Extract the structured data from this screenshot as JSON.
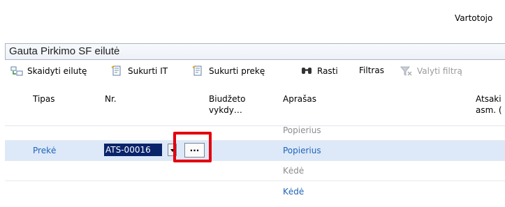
{
  "header": {
    "user_label": "Vartotojo"
  },
  "panel": {
    "title": "Gauta Pirkimo SF eilutė"
  },
  "toolbar": {
    "split_line": "Skaidyti eilutę",
    "create_it": "Sukurti IT",
    "create_item": "Sukurti prekę",
    "find": "Rasti",
    "filter": "Filtras",
    "clear_filter": "Valyti filtrą"
  },
  "columns": {
    "type": "Tipas",
    "nr": "Nr.",
    "budget_1": "Biudžeto",
    "budget_2": "vykdy…",
    "description": "Aprašas",
    "resp_1": "Atsaki",
    "resp_2": "asm. ("
  },
  "rows": [
    {
      "type": "",
      "nr": "",
      "description": "Popierius"
    },
    {
      "type": "Prekė",
      "nr": "ATS-00016",
      "description": "Popierius",
      "ellipsis": "..."
    },
    {
      "type": "",
      "nr": "",
      "description": "Kėdė"
    },
    {
      "type": "",
      "nr": "",
      "description": "Kėdė"
    }
  ],
  "colors": {
    "accent": "#1e62b8",
    "highlight": "#e3000f",
    "selection": "#0a246a"
  }
}
